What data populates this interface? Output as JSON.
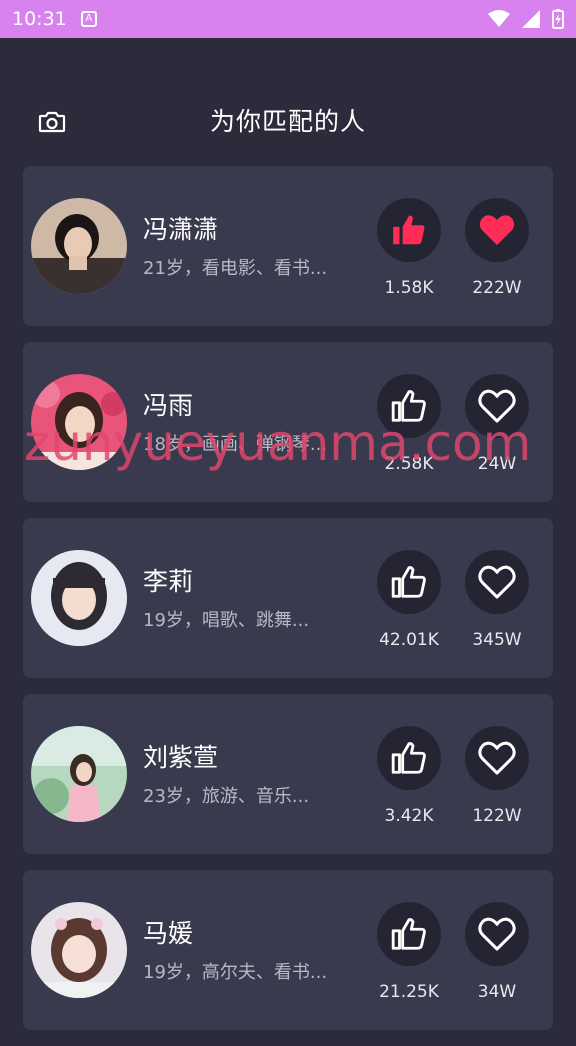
{
  "status": {
    "time": "10:31",
    "badge": "A"
  },
  "header": {
    "title": "为你匹配的人"
  },
  "watermark": "zunyueyuanma.com",
  "profiles": [
    {
      "name": "冯潇潇",
      "desc": "21岁，看电影、看书...",
      "likes": "1.58K",
      "favs": "222W",
      "liked": true,
      "favorited": true
    },
    {
      "name": "冯雨",
      "desc": "18岁，画画、弹钢琴...",
      "likes": "2.58K",
      "favs": "24W",
      "liked": false,
      "favorited": false
    },
    {
      "name": "李莉",
      "desc": "19岁，唱歌、跳舞...",
      "likes": "42.01K",
      "favs": "345W",
      "liked": false,
      "favorited": false
    },
    {
      "name": "刘紫萱",
      "desc": "23岁，旅游、音乐...",
      "likes": "3.42K",
      "favs": "122W",
      "liked": false,
      "favorited": false
    },
    {
      "name": "马媛",
      "desc": "19岁，高尔夫、看书...",
      "likes": "21.25K",
      "favs": "34W",
      "liked": false,
      "favorited": false
    }
  ],
  "colors": {
    "accent": "#ff2d55",
    "statusbar": "#d782ef",
    "background": "#2b2b3b",
    "card": "#393a4d"
  }
}
